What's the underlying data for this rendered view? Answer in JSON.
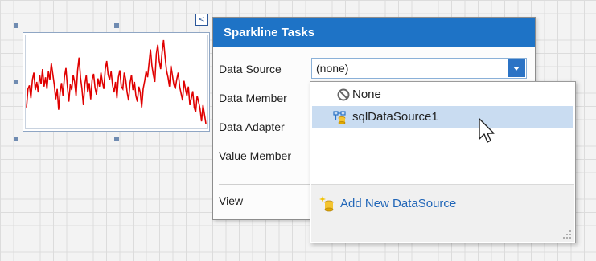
{
  "smart_tag": {
    "glyph": "<"
  },
  "sparkline": {
    "values": [
      42,
      58,
      61,
      50,
      66,
      72,
      57,
      64,
      55,
      70,
      62,
      75,
      60,
      68,
      58,
      73,
      66,
      80,
      71,
      62,
      49,
      58,
      40,
      55,
      63,
      52,
      68,
      76,
      60,
      47,
      62,
      57,
      70,
      64,
      52,
      74,
      85,
      68,
      58,
      44,
      62,
      70,
      55,
      63,
      49,
      66,
      71,
      59,
      53,
      67,
      60,
      72,
      64,
      58,
      75,
      82,
      70,
      66,
      73,
      61,
      55,
      64,
      50,
      68,
      74,
      60,
      58,
      72,
      66,
      55,
      48,
      63,
      70,
      57,
      64,
      52,
      47,
      60,
      55,
      42,
      58,
      65,
      73,
      68,
      80,
      92,
      78,
      70,
      64,
      88,
      96,
      82,
      75,
      90,
      100,
      86,
      74,
      68,
      60,
      78,
      70,
      62,
      58,
      66,
      72,
      60,
      54,
      48,
      65,
      58,
      52,
      60,
      44,
      50,
      56,
      42,
      38,
      52,
      47,
      41,
      30,
      44,
      36,
      28
    ]
  },
  "tasks_panel": {
    "title": "Sparkline Tasks",
    "labels": {
      "data_source": "Data Source",
      "data_member": "Data Member",
      "data_adapter": "Data Adapter",
      "value_member": "Value Member",
      "view": "View"
    },
    "data_source_value": "(none)"
  },
  "dropdown": {
    "items": [
      {
        "label": "None",
        "icon": "none-icon"
      },
      {
        "label": "sqlDataSource1",
        "icon": "sql-data-source-icon"
      }
    ],
    "add_label": "Add New DataSource"
  },
  "colors": {
    "accent": "#1e73c6",
    "sparkline": "#e00000",
    "selection": "#c9dcf1"
  }
}
